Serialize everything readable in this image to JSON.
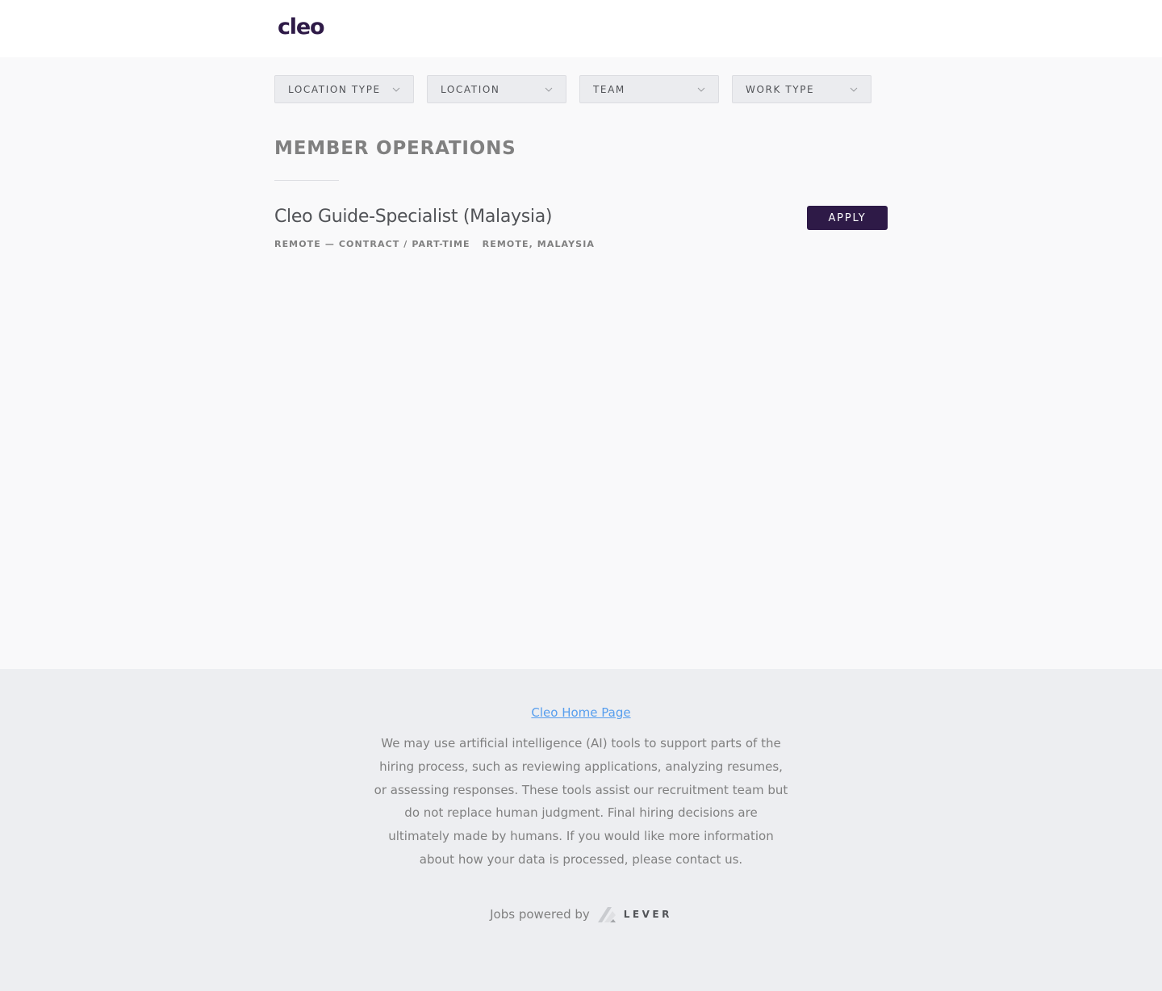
{
  "header": {
    "logo_text": "cleo",
    "logo_color": "#2e1a47"
  },
  "filters": [
    {
      "label": "LOCATION TYPE"
    },
    {
      "label": "LOCATION"
    },
    {
      "label": "TEAM"
    },
    {
      "label": "WORK TYPE"
    }
  ],
  "section": {
    "title": "MEMBER OPERATIONS"
  },
  "posting": {
    "title": "Cleo Guide-Specialist (Malaysia)",
    "commitment": "REMOTE — CONTRACT / PART-TIME",
    "location": "REMOTE, MALAYSIA",
    "apply_label": "APPLY"
  },
  "footer": {
    "home_link": "Cleo Home Page",
    "ai_notice": "We may use artificial intelligence (AI) tools to support parts of the hiring process, such as reviewing applications, analyzing resumes, or assessing responses. These tools assist our recruitment team but do not replace human judgment. Final hiring decisions are ultimately made by humans. If you would like more information about how your data is processed, please contact us.",
    "powered_by": "Jobs powered by",
    "lever_text": "LEVER"
  },
  "colors": {
    "accent": "#2e1a47",
    "link": "#579eee",
    "page_bg": "#f9f9fa",
    "footer_bg": "#edeef1"
  }
}
